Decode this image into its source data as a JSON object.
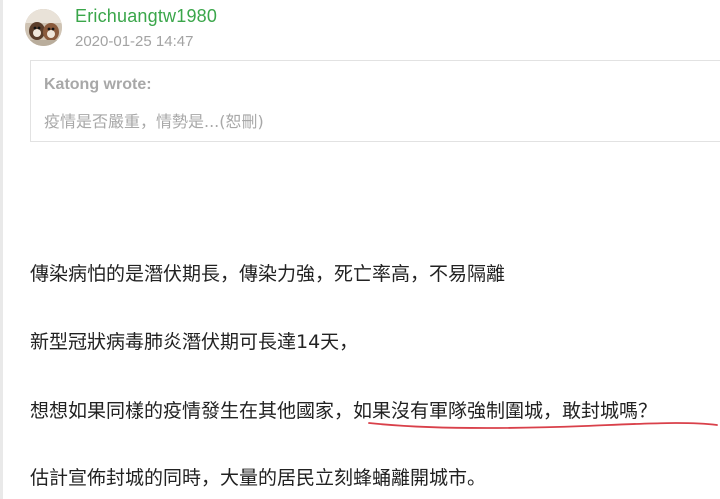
{
  "post": {
    "username": "Erichuangtw1980",
    "timestamp": "2020-01-25 14:47",
    "quote": {
      "author": "Katong wrote:",
      "text": "疫情是否嚴重，情勢是...(恕刪)"
    },
    "paragraphs": {
      "p1": "傳染病怕的是潛伏期長，傳染力強，死亡率高，不易隔離",
      "p2": "新型冠狀病毒肺炎潛伏期可長達14天，",
      "p3": "想想如果同樣的疫情發生在其他國家，如果沒有軍隊強制圍城，敢封城嗎？",
      "p4": "估計宣佈封城的同時，大量的居民立刻蜂蛹離開城市。"
    }
  },
  "colors": {
    "username": "#3aa64a",
    "meta_gray": "#a3a3a3",
    "body_text": "#222222",
    "annotation_red": "#d9404a"
  },
  "icons": {
    "avatar": "user-avatar-photo"
  }
}
